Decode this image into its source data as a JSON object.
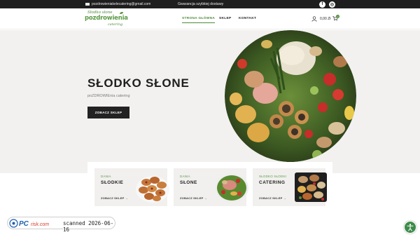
{
  "topbar": {
    "email": "pozdrowieniakelecatering@gmail.com",
    "promo": "Gwarancja szybkiej dostawy",
    "social": [
      {
        "icon": "facebook-icon",
        "glyph": "f"
      },
      {
        "icon": "instagram-icon",
        "glyph": "◎"
      }
    ]
  },
  "header": {
    "logo": {
      "line1": "Słodko słone",
      "line2": "pozdrowienia",
      "line3": "catering"
    },
    "nav": [
      {
        "label": "STRONA GŁÓWNA",
        "active": true
      },
      {
        "label": "SKLEP",
        "active": false
      },
      {
        "label": "KONTAKT",
        "active": false
      }
    ],
    "cart_total": "0,00 Zł",
    "cart_count": "0"
  },
  "hero": {
    "title": "SŁODKO SŁONE",
    "subtitle": "poZDROWIEnia catering",
    "button_label": "ZOBACZ SKLEP"
  },
  "categories": [
    {
      "kicker": "DANIA",
      "name": "SŁODKIE",
      "link": "ZOBACZ SKLEP →"
    },
    {
      "kicker": "DANIA",
      "name": "SŁONE",
      "link": "ZOBACZ SKLEP →"
    },
    {
      "kicker": "SŁODKO SŁODKI",
      "name": "CATERING",
      "link": "ZOBACZ SKLEP →"
    }
  ],
  "badge": {
    "text": "scanned 2026-06-16"
  },
  "colors": {
    "accent_green": "#4e8a3a",
    "dark": "#1e1e1e",
    "hero_bg": "#f2f1ef"
  }
}
